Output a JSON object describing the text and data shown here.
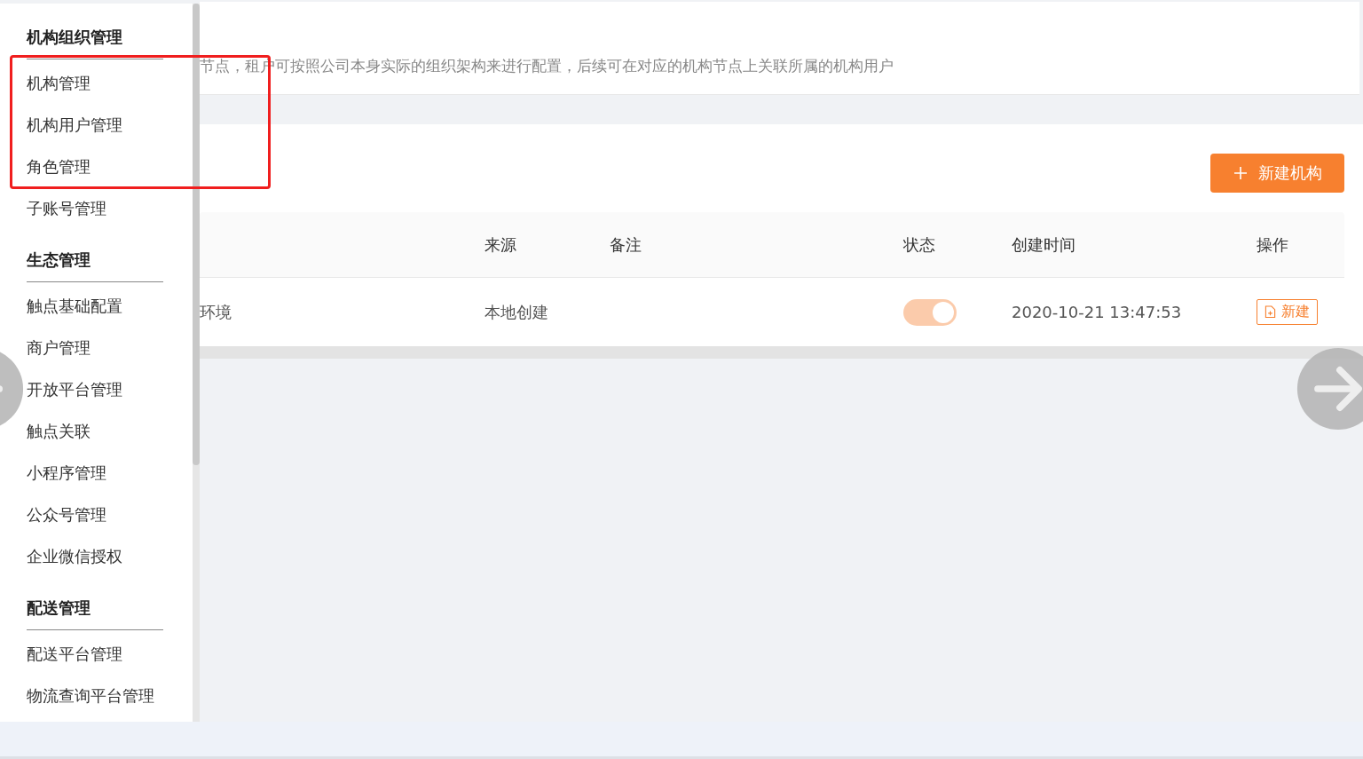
{
  "sidebar": {
    "groups": [
      {
        "title": "机构组织管理",
        "items": [
          {
            "label": "机构管理"
          },
          {
            "label": "机构用户管理"
          },
          {
            "label": "角色管理"
          },
          {
            "label": "子账号管理"
          }
        ]
      },
      {
        "title": "生态管理",
        "items": [
          {
            "label": "触点基础配置"
          },
          {
            "label": "商户管理"
          },
          {
            "label": "开放平台管理"
          },
          {
            "label": "触点关联"
          },
          {
            "label": "小程序管理"
          },
          {
            "label": "公众号管理"
          },
          {
            "label": "企业微信授权"
          }
        ]
      },
      {
        "title": "配送管理",
        "items": [
          {
            "label": "配送平台管理"
          },
          {
            "label": "物流查询平台管理"
          }
        ]
      }
    ]
  },
  "header": {
    "description": "节点，租户可按照公司本身实际的组织架构来进行配置，后续可在对应的机构节点上关联所属的机构用户"
  },
  "toolbar": {
    "new_button": "新建机构"
  },
  "table": {
    "columns": [
      {
        "label": "来源"
      },
      {
        "label": "备注"
      },
      {
        "label": "状态"
      },
      {
        "label": "创建时间"
      },
      {
        "label": "操作"
      }
    ],
    "rows": [
      {
        "column_1": "环境",
        "source": "本地创建",
        "status": {
          "on": true,
          "disabled": true
        },
        "created": "2020-10-21 13:47:53",
        "action": "新建"
      }
    ]
  }
}
